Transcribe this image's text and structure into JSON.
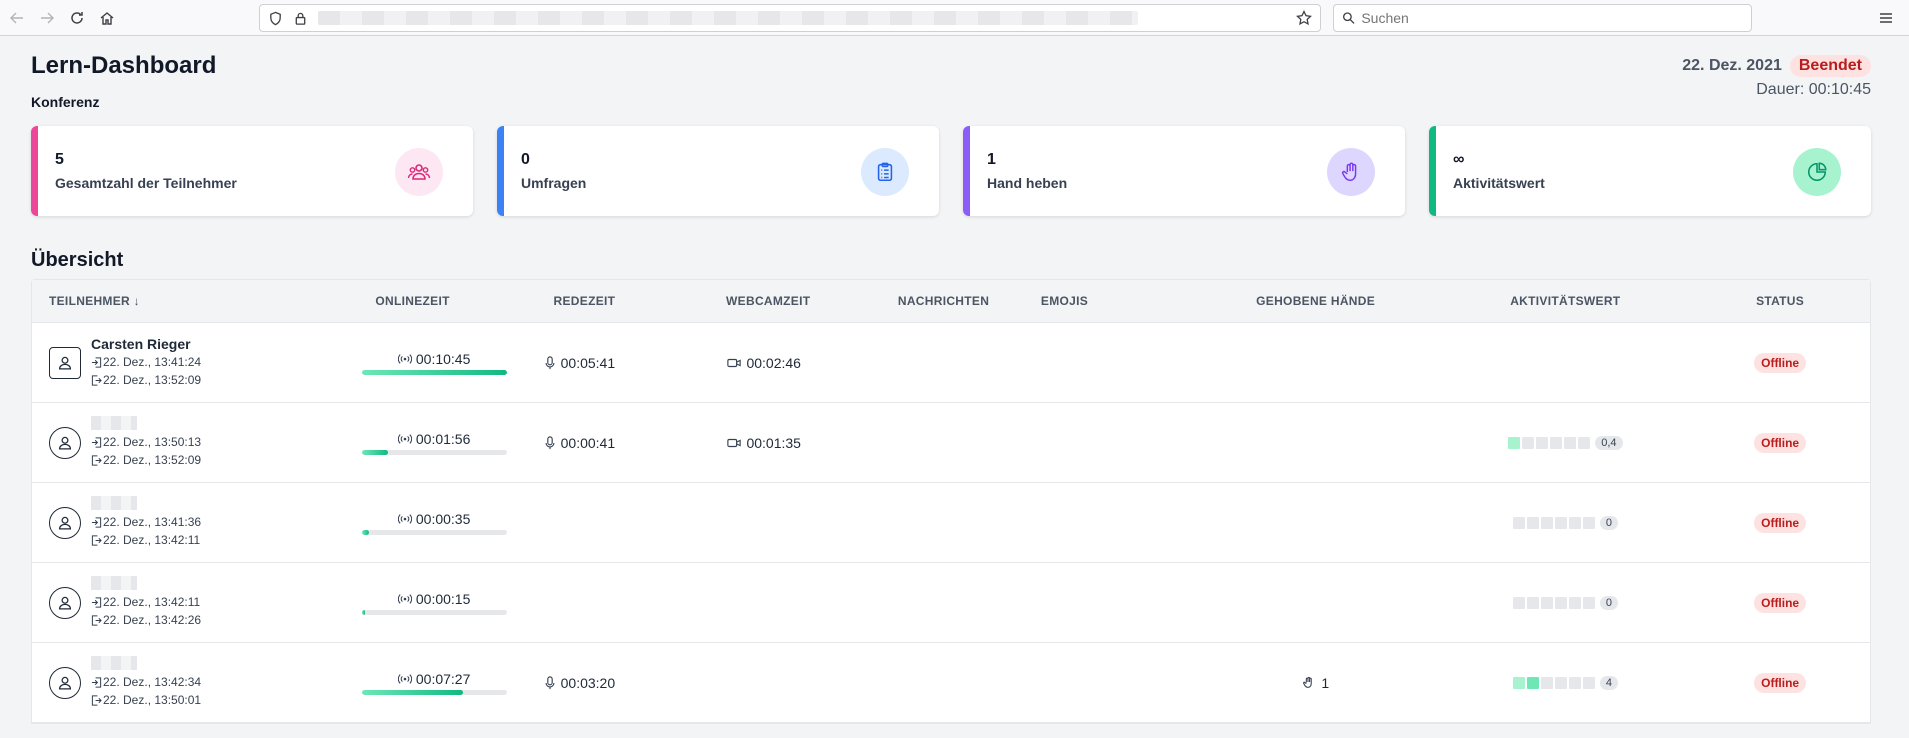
{
  "browser": {
    "search_placeholder": "Suchen"
  },
  "header": {
    "title": "Lern-Dashboard",
    "subtitle": "Konferenz",
    "date": "22. Dez. 2021",
    "status_badge": "Beendet",
    "duration": "Dauer: 00:10:45"
  },
  "cards": [
    {
      "value": "5",
      "label": "Gesamtzahl der Teilnehmer",
      "icon": "users-icon",
      "color": "#ec4899"
    },
    {
      "value": "0",
      "label": "Umfragen",
      "icon": "clipboard-icon",
      "color": "#3b82f6"
    },
    {
      "value": "1",
      "label": "Hand heben",
      "icon": "hand-icon",
      "color": "#8b5cf6"
    },
    {
      "value": "∞",
      "label": "Aktivitätswert",
      "icon": "pie-chart-icon",
      "color": "#10b981"
    }
  ],
  "section_title": "Übersicht",
  "table": {
    "headers": [
      "TEILNEHMER ↓",
      "ONLINEZEIT",
      "REDEZEIT",
      "WEBCAMZEIT",
      "NACHRICHTEN",
      "EMOJIS",
      "GEHOBENE HÄNDE",
      "AKTIVITÄTSWERT",
      "STATUS"
    ],
    "rows": [
      {
        "name": "Carsten Rieger",
        "joined": "22. Dez., 13:41:24",
        "left": "22. Dez., 13:52:09",
        "online": "00:10:45",
        "online_fraction": 1.0,
        "talk": "00:05:41",
        "webcam": "00:02:46",
        "messages": "",
        "emojis": "",
        "hands": "",
        "activity_value": "",
        "activity_levels": [],
        "status": "Offline"
      },
      {
        "name": "",
        "joined": "22. Dez., 13:50:13",
        "left": "22. Dez., 13:52:09",
        "online": "00:01:56",
        "online_fraction": 0.18,
        "talk": "00:00:41",
        "webcam": "00:01:35",
        "messages": "",
        "emojis": "",
        "hands": "",
        "activity_value": "0,4",
        "activity_levels": [
          1,
          0,
          0,
          0,
          0,
          0
        ],
        "status": "Offline"
      },
      {
        "name": "",
        "joined": "22. Dez., 13:41:36",
        "left": "22. Dez., 13:42:11",
        "online": "00:00:35",
        "online_fraction": 0.05,
        "talk": "",
        "webcam": "",
        "messages": "",
        "emojis": "",
        "hands": "",
        "activity_value": "0",
        "activity_levels": [
          0,
          0,
          0,
          0,
          0,
          0
        ],
        "status": "Offline"
      },
      {
        "name": "",
        "joined": "22. Dez., 13:42:11",
        "left": "22. Dez., 13:42:26",
        "online": "00:00:15",
        "online_fraction": 0.02,
        "talk": "",
        "webcam": "",
        "messages": "",
        "emojis": "",
        "hands": "",
        "activity_value": "0",
        "activity_levels": [
          0,
          0,
          0,
          0,
          0,
          0
        ],
        "status": "Offline"
      },
      {
        "name": "",
        "joined": "22. Dez., 13:42:34",
        "left": "22. Dez., 13:50:01",
        "online": "00:07:27",
        "online_fraction": 0.7,
        "talk": "00:03:20",
        "webcam": "",
        "messages": "",
        "emojis": "",
        "hands": "1",
        "activity_value": "4",
        "activity_levels": [
          1,
          2,
          0,
          0,
          0,
          0
        ],
        "status": "Offline"
      }
    ]
  }
}
